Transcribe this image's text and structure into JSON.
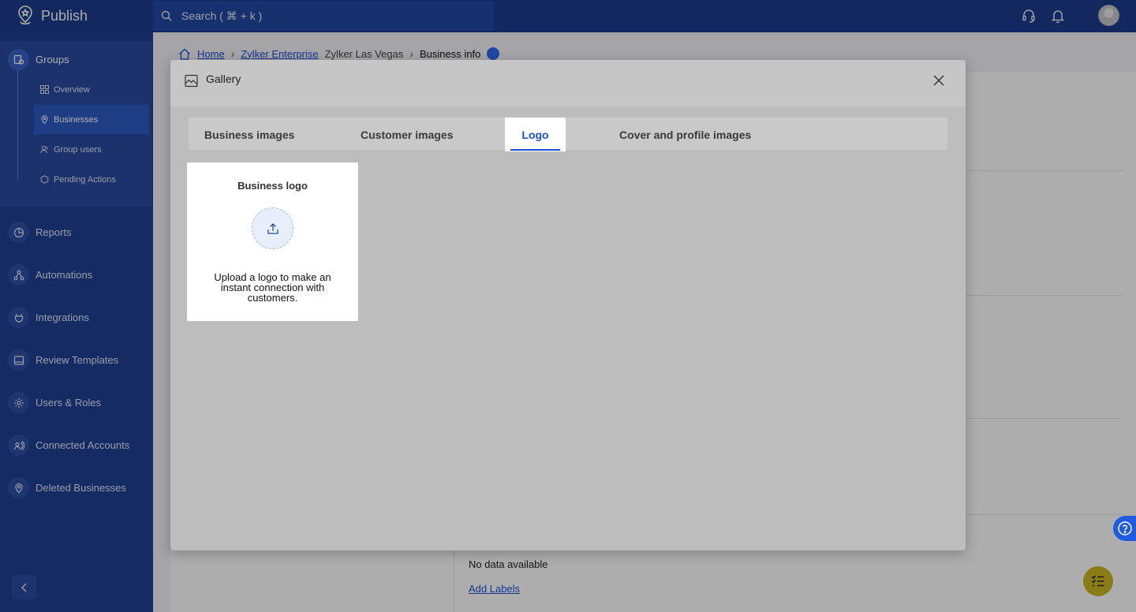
{
  "app": {
    "name": "Publish"
  },
  "search": {
    "placeholder": "Search ( ⌘ + k )"
  },
  "header_icons": [
    "headset-icon",
    "bell-icon",
    "avatar"
  ],
  "sidebar": {
    "groups": {
      "label": "Groups",
      "icon": "groups-icon",
      "items": [
        {
          "label": "Overview",
          "icon": "overview-icon"
        },
        {
          "label": "Businesses",
          "icon": "location-pin-icon",
          "active": true
        },
        {
          "label": "Group users",
          "icon": "user-icon"
        },
        {
          "label": "Pending Actions",
          "icon": "pending-icon"
        }
      ]
    },
    "items": [
      {
        "label": "Reports",
        "icon": "reports-icon"
      },
      {
        "label": "Automations",
        "icon": "automations-icon"
      },
      {
        "label": "Integrations",
        "icon": "integrations-icon"
      },
      {
        "label": "Review Templates",
        "icon": "templates-icon"
      },
      {
        "label": "Users & Roles",
        "icon": "gear-icon"
      },
      {
        "label": "Connected Accounts",
        "icon": "accounts-icon"
      },
      {
        "label": "Deleted Businesses",
        "icon": "location-pin-icon"
      }
    ]
  },
  "breadcrumb": {
    "home": "Home",
    "enterprise": "Zylker Enterprise",
    "location": "Zylker Las Vegas",
    "current": "Business info"
  },
  "background": {
    "no_data": "No data available",
    "add_labels": "Add Labels"
  },
  "modal": {
    "title": "Gallery",
    "tabs": [
      {
        "label": "Business images"
      },
      {
        "label": "Customer images"
      },
      {
        "label": "Logo",
        "active": true
      },
      {
        "label": "Cover and profile images"
      }
    ],
    "logo_card": {
      "title": "Business logo",
      "description": "Upload a logo to make an instant connection with customers."
    }
  },
  "colors": {
    "topbar": "#1d3b8b",
    "sidebar": "#1f4092",
    "accent": "#1d4ed8",
    "tasks_fab": "#8a7c17"
  }
}
